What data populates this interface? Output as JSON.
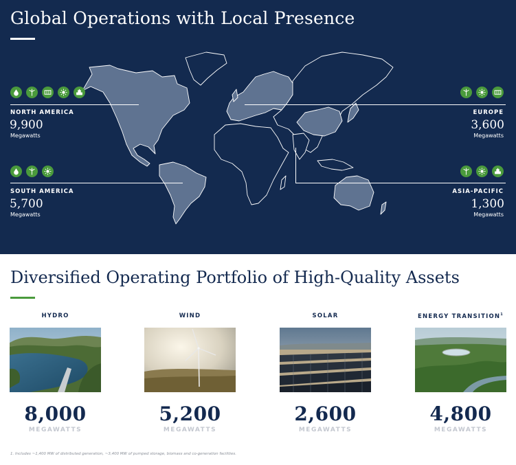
{
  "map_section": {
    "title": "Global Operations with Local Presence",
    "regions": [
      {
        "name": "NORTH AMERICA",
        "value": "9,900",
        "unit": "Megawatts",
        "icons": [
          "hydro-icon",
          "wind-icon",
          "solar-icon",
          "distributed-generation-icon",
          "storage-icon"
        ]
      },
      {
        "name": "SOUTH AMERICA",
        "value": "5,700",
        "unit": "Megawatts",
        "icons": [
          "hydro-icon",
          "wind-icon",
          "distributed-generation-icon"
        ]
      },
      {
        "name": "EUROPE",
        "value": "3,600",
        "unit": "Megawatts",
        "icons": [
          "wind-icon",
          "distributed-generation-icon",
          "solar-icon"
        ]
      },
      {
        "name": "ASIA-PACIFIC",
        "value": "1,300",
        "unit": "Megawatts",
        "icons": [
          "wind-icon",
          "distributed-generation-icon",
          "storage-icon"
        ]
      }
    ]
  },
  "portfolio_section": {
    "title": "Diversified Operating Portfolio of High-Quality Assets",
    "assets": [
      {
        "label": "HYDRO",
        "footnote_mark": "",
        "value": "8,000",
        "unit": "MEGAWATTS"
      },
      {
        "label": "WIND",
        "footnote_mark": "",
        "value": "5,200",
        "unit": "MEGAWATTS"
      },
      {
        "label": "SOLAR",
        "footnote_mark": "",
        "value": "2,600",
        "unit": "MEGAWATTS"
      },
      {
        "label": "ENERGY TRANSITION",
        "footnote_mark": "1",
        "value": "4,800",
        "unit": "MEGAWATTS"
      }
    ]
  },
  "footnote": "1.    Includes ~1,400 MW of distributed generation, ~3,400 MW of pumped storage, biomass and co-generation facilities.",
  "colors": {
    "navy": "#132a4f",
    "green": "#4a9a3c",
    "land_highlight": "#5f7391",
    "land": "#132a4f"
  }
}
